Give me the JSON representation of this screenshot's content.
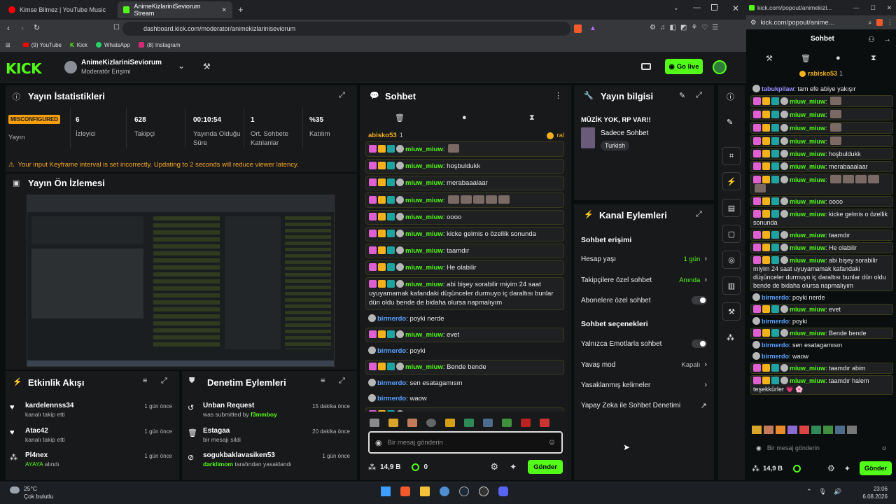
{
  "browser": {
    "tabs": [
      {
        "label": "Kimse Bilmez | YouTube Music"
      },
      {
        "label": "AnimeKizlariniSeviorum Stream"
      }
    ],
    "url": "dashboard.kick.com/moderator/animekizlariniseviorum",
    "bookmarks": [
      "(9) YouTube",
      "Kick",
      "WhatsApp",
      "(8) Instagram"
    ]
  },
  "header": {
    "logo": "KICK",
    "channel": "AnimeKizlariniSeviorum",
    "role": "Moderatör Erişimi",
    "go_live": "Go live"
  },
  "stats_panel": {
    "title": "Yayın İstatistikleri",
    "stats": [
      {
        "value": "MISCONFIGURED",
        "label": "Yayın"
      },
      {
        "value": "6",
        "label": "İzleyici"
      },
      {
        "value": "628",
        "label": "Takipçi"
      },
      {
        "value": "00:10:54",
        "label": "Yayında Olduğu Süre"
      },
      {
        "value": "1",
        "label": "Ort. Sohbete Katılanlar"
      },
      {
        "value": "%35",
        "label": "Katılım"
      }
    ],
    "warning": "Your input Keyframe interval is set incorrectly. Updating to 2 seconds will reduce viewer latency."
  },
  "preview": {
    "title": "Yayın Ön İzlemesi"
  },
  "activity": {
    "title": "Etkinlik Akışı",
    "items": [
      {
        "name": "kardelennss34",
        "sub": "kanalı takip etti",
        "time": "1 gün önce"
      },
      {
        "name": "Atac42",
        "sub": "kanalı takip etti",
        "time": "1 gün önce"
      },
      {
        "name": "Pl4nex",
        "sub_hl": "AYAYA",
        "sub": " alındı",
        "time": "1 gün önce"
      }
    ]
  },
  "moderation": {
    "title": "Denetim Eylemleri",
    "items": [
      {
        "name": "Unban Request",
        "sub": "was submitted by ",
        "who": "f3mmboy",
        "time": "15 dakika önce"
      },
      {
        "name": "Estagaa",
        "sub": "bir mesajı sildi",
        "who": "",
        "time": "20 dakika önce"
      },
      {
        "name": "sogukbaklavasiken53",
        "sub": " tarafından yasaklandı",
        "who": "darklimom",
        "time": "1 gün önce"
      }
    ]
  },
  "chat": {
    "title": "Sohbet",
    "pinned_user": "abisko53",
    "pinned_count": "1",
    "pinned_tag": "ral",
    "messages": [
      {
        "user": "miuw_miuw",
        "text": "",
        "style": "sub",
        "emotes": 1
      },
      {
        "user": "miuw_miuw",
        "text": "hoşbuldukk",
        "style": "sub",
        "emotes": 0
      },
      {
        "user": "miuw_miuw",
        "text": "merabaaalaar",
        "style": "sub",
        "emotes": 0
      },
      {
        "user": "miuw_miuw",
        "text": "",
        "style": "sub",
        "emotes": 5
      },
      {
        "user": "miuw_miuw",
        "text": "oooo",
        "style": "sub",
        "emotes": 0
      },
      {
        "user": "miuw_miuw",
        "text": "kicke gelmis o özellik sonunda",
        "style": "sub",
        "emotes": 0
      },
      {
        "user": "miuw_miuw",
        "text": "taamdır",
        "style": "sub",
        "emotes": 0
      },
      {
        "user": "miuw_miuw",
        "text": "He olabilir",
        "style": "sub",
        "emotes": 0
      },
      {
        "user": "miuw_miuw",
        "text": "abi bişey sorabilir miyim 24 saat uyuyamamak kafandaki düşünceler durmuyo iç daraltısı bunlar dün oldu bende de bidaha olursa napmalıyım",
        "style": "sub",
        "emotes": 0
      },
      {
        "user": "birmerdo",
        "text": "poyki nerde",
        "style": "plain",
        "emotes": 0
      },
      {
        "user": "miuw_miuw",
        "text": "evet",
        "style": "sub",
        "emotes": 0
      },
      {
        "user": "birmerdo",
        "text": "poyki",
        "style": "plain",
        "emotes": 0
      },
      {
        "user": "miuw_miuw",
        "text": "Bende bende",
        "style": "sub",
        "emotes": 0
      },
      {
        "user": "birmerdo",
        "text": "sen esatagamısın",
        "style": "plain",
        "emotes": 0
      },
      {
        "user": "birmerdo",
        "text": "waow",
        "style": "plain",
        "emotes": 0
      },
      {
        "user": "miuw_miuw",
        "text": "taamdır abim",
        "style": "sub",
        "emotes": 0
      },
      {
        "user": "miuw_miuw",
        "text": "taamdır halem teşekkürler 💗 🌸",
        "style": "sub",
        "emotes": 0
      }
    ],
    "input_placeholder": "Bir mesaj gönderin",
    "points": "14,9 B",
    "zero": "0",
    "send": "Gönder"
  },
  "stream_info": {
    "title": "Yayın bilgisi",
    "stream_title": "MÜZİK YOK, RP VAR!!",
    "category": "Sadece Sohbet",
    "tag": "Turkish"
  },
  "channel_actions": {
    "title": "Kanal Eylemleri",
    "access_header": "Sohbet erişimi",
    "access": [
      {
        "label": "Hesap yaşı",
        "value": "1 gün"
      },
      {
        "label": "Takipçilere özel sohbet",
        "value": "Anında"
      },
      {
        "label": "Abonelere özel sohbet",
        "value": ""
      }
    ],
    "options_header": "Sohbet seçenekleri",
    "options": [
      {
        "label": "Yalnızca Emotlarla sohbet",
        "value": ""
      },
      {
        "label": "Yavaş mod",
        "value": "Kapalı"
      },
      {
        "label": "Yasaklanmış kelimeler",
        "value": ""
      },
      {
        "label": "Yapay Zeka ile Sohbet Denetimi",
        "value": ""
      }
    ]
  },
  "popout": {
    "url": "kick.com/popout/animekizl...",
    "url2": "kick.com/popout/anime...",
    "title": "Sohbet",
    "pinned_user": "rabisko53",
    "pinned_count": "1",
    "messages": [
      {
        "user": "tabukpilaw",
        "text": "tam efe abiye yakışır",
        "style": "plain",
        "emotes": 0
      },
      {
        "user": "miuw_miuw",
        "text": "",
        "style": "sub",
        "emotes": 1
      },
      {
        "user": "miuw_miuw",
        "text": "",
        "style": "sub",
        "emotes": 1
      },
      {
        "user": "miuw_miuw",
        "text": "",
        "style": "sub",
        "emotes": 1
      },
      {
        "user": "miuw_miuw",
        "text": "",
        "style": "sub",
        "emotes": 1
      },
      {
        "user": "miuw_miuw",
        "text": "hoşbuldukk",
        "style": "sub",
        "emotes": 0
      },
      {
        "user": "miuw_miuw",
        "text": "merabaaalaar",
        "style": "sub",
        "emotes": 0
      },
      {
        "user": "miuw_miuw",
        "text": "",
        "style": "sub",
        "emotes": 5
      },
      {
        "user": "miuw_miuw",
        "text": "oooo",
        "style": "sub",
        "emotes": 0
      },
      {
        "user": "miuw_miuw",
        "text": "kicke gelmis o özellik sonunda",
        "style": "sub",
        "emotes": 0
      },
      {
        "user": "miuw_miuw",
        "text": "taamdır",
        "style": "sub",
        "emotes": 0
      },
      {
        "user": "miuw_miuw",
        "text": "He olabilir",
        "style": "sub",
        "emotes": 0
      },
      {
        "user": "miuw_miuw",
        "text": "abi bişey sorabilir miyim 24 saat uyuyamamak kafandaki düşünceler durmuyo iç daraltısı bunlar dün oldu bende de bidaha olursa napmalıyım",
        "style": "sub",
        "emotes": 0
      },
      {
        "user": "birmerdo",
        "text": "poyki nerde",
        "style": "plain",
        "emotes": 0
      },
      {
        "user": "miuw_miuw",
        "text": "evet",
        "style": "sub",
        "emotes": 0
      },
      {
        "user": "birmerdo",
        "text": "poyki",
        "style": "plain",
        "emotes": 0
      },
      {
        "user": "miuw_miuw",
        "text": "Bende bende",
        "style": "sub",
        "emotes": 0
      },
      {
        "user": "birmerdo",
        "text": "sen esatagamısın",
        "style": "plain",
        "emotes": 0
      },
      {
        "user": "birmerdo",
        "text": "waow",
        "style": "plain",
        "emotes": 0
      },
      {
        "user": "miuw_miuw",
        "text": "taamdır abim",
        "style": "sub",
        "emotes": 0
      },
      {
        "user": "miuw_miuw",
        "text": "taamdır halem teşekkürler 💗 🌸",
        "style": "sub",
        "emotes": 0
      }
    ],
    "input_placeholder": "Bir mesaj gönderin",
    "points": "14,9 B",
    "send": "Gönder"
  },
  "taskbar": {
    "temp": "25°C",
    "weather": "Çok bulutlu",
    "time": "23:06",
    "date": "6.08.2026"
  }
}
